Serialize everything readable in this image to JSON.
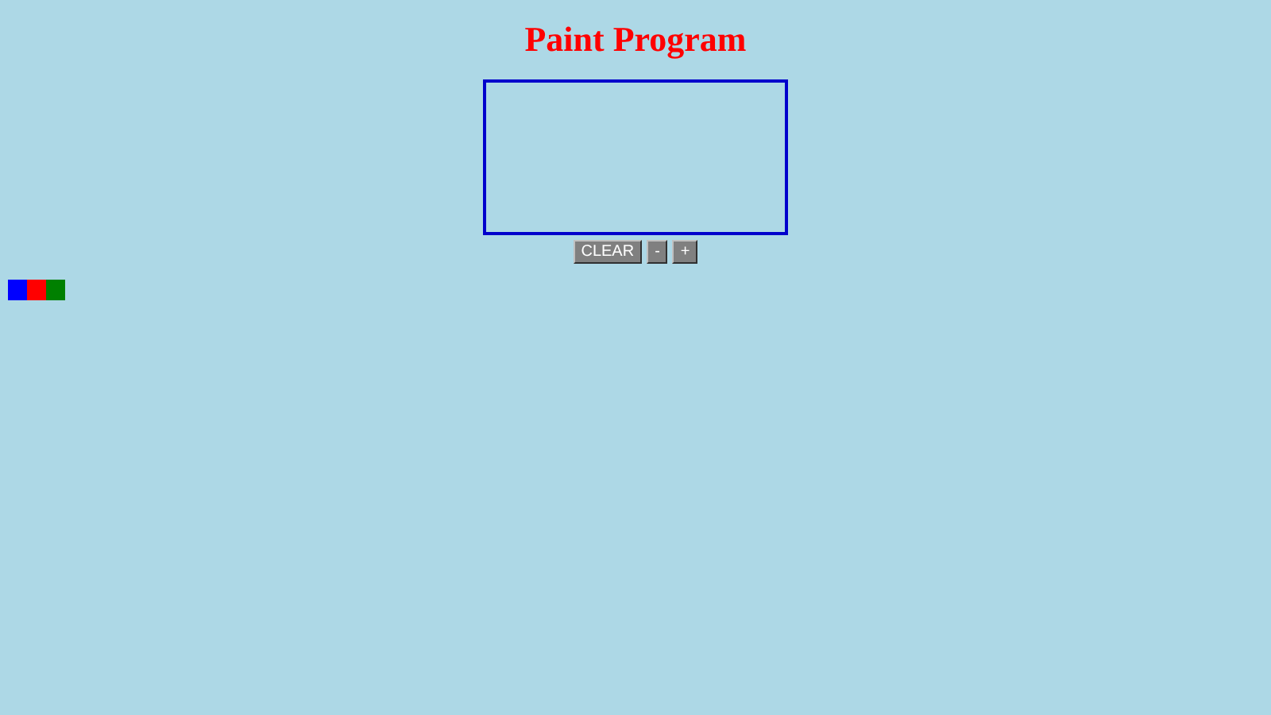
{
  "title": "Paint Program",
  "buttons": [
    "CLEAR",
    "-",
    "+"
  ],
  "palette": [
    {
      "color": "#0000ff"
    },
    {
      "color": "#ff0000"
    },
    {
      "color": "#008000"
    }
  ]
}
